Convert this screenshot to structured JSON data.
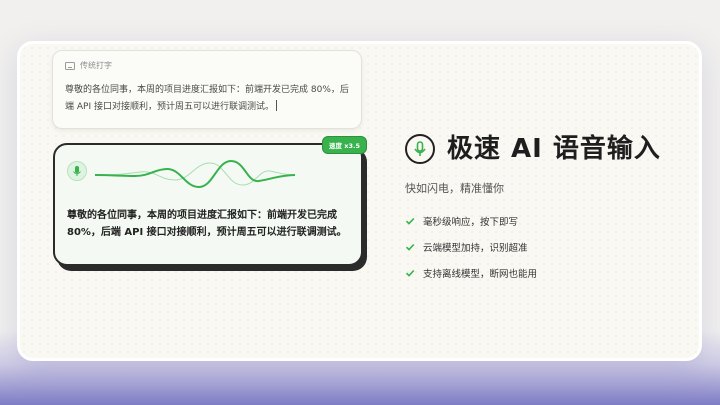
{
  "traditional": {
    "label": "传统打字",
    "text": "尊敬的各位同事，本周的项目进度汇报如下：前端开发已完成 80%，后端 API 接口对接顺利，预计周五可以进行联调测试。"
  },
  "ai_input": {
    "speed_badge": "速度 x3.5",
    "text": "尊敬的各位同事，本周的项目进度汇报如下：前端开发已完成 80%，后端 API 接口对接顺利，预计周五可以进行联调测试。"
  },
  "hero": {
    "title": "极速 AI 语音输入",
    "subtitle": "快如闪电，精准懂你"
  },
  "features": [
    "毫秒级响应，按下即写",
    "云端模型加持，识别超准",
    "支持离线模型，断网也能用"
  ],
  "colors": {
    "accent": "#37b24d",
    "ink": "#222222",
    "card": "#f9f8f2"
  },
  "icons": {
    "traditional": "keyboard-icon",
    "ai": "microphone-icon",
    "feature": "check-icon"
  }
}
